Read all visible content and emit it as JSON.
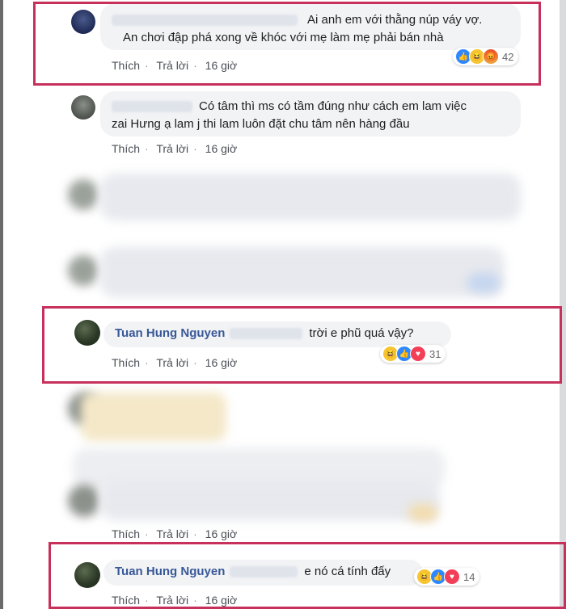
{
  "comments": [
    {
      "line1": "Ai anh em với thằng núp váy vợ.",
      "line2": "An chơi đập phá xong về khóc với mẹ làm mẹ phải bán nhà",
      "like": "Thích",
      "reply": "Trả lời",
      "time": "16 giờ",
      "reactions": {
        "count": "42"
      }
    },
    {
      "line1": "Có tâm thì ms có tầm đúng như cách em lam việc",
      "line2": "zai Hưng ạ lam j thi lam luôn đặt chu tâm nên hàng đầu",
      "like": "Thích",
      "reply": "Trả lời",
      "time": "16 giờ"
    },
    {
      "name": "Tuan Hung Nguyen",
      "text": "trời e phũ quá vậy?",
      "like": "Thích",
      "reply": "Trả lời",
      "time": "16 giờ",
      "reactions": {
        "count": "31"
      }
    },
    {
      "like": "Thích",
      "reply": "Trả lời",
      "time": "16 giờ"
    },
    {
      "name": "Tuan Hung Nguyen",
      "text": "e nó cá tính đấy",
      "like": "Thích",
      "reply": "Trả lời",
      "time": "16 giờ",
      "reactions": {
        "count": "14"
      }
    }
  ],
  "colors": {
    "highlight": "#c7305b",
    "link": "#385898",
    "bubble": "#f2f3f5"
  }
}
